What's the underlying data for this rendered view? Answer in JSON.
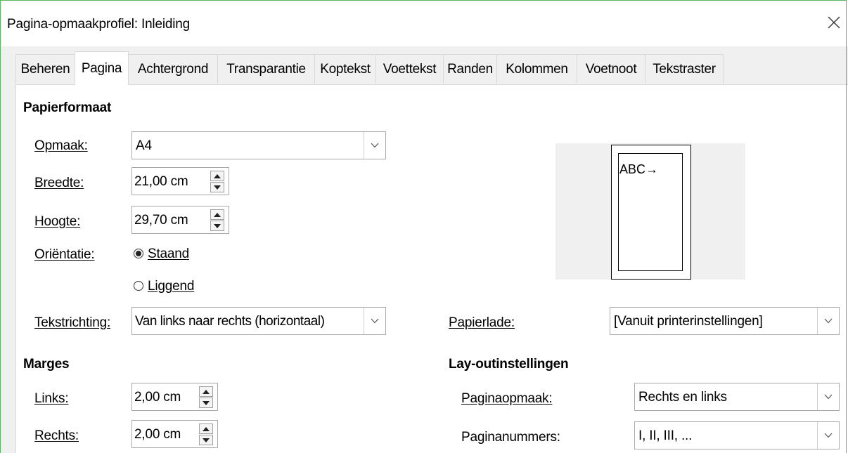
{
  "window": {
    "title": "Pagina-opmaakprofiel: Inleiding",
    "close_icon": "close-icon"
  },
  "tabs": [
    "Beheren",
    "Pagina",
    "Achtergrond",
    "Transparantie",
    "Koptekst",
    "Voettekst",
    "Randen",
    "Kolommen",
    "Voetnoot",
    "Tekstraster"
  ],
  "active_tab": "Pagina",
  "paper_format": {
    "heading": "Papierformaat",
    "format_label": "Opmaak:",
    "format_value": "A4",
    "width_label": "Breedte:",
    "width_value": "21,00 cm",
    "height_label": "Hoogte:",
    "height_value": "29,70 cm",
    "orientation_label": "Oriëntatie:",
    "portrait_label": "Staand",
    "landscape_label": "Liggend",
    "orientation_selected": "Staand",
    "text_direction_label": "Tekstrichting:",
    "text_direction_value": "Van links naar rechts (horizontaal)"
  },
  "preview": {
    "sample_text": "ABC→"
  },
  "paper_tray": {
    "label": "Papierlade:",
    "value": "[Vanuit printerinstellingen]"
  },
  "margins": {
    "heading": "Marges",
    "left_label": "Links:",
    "left_value": "2,00 cm",
    "right_label": "Rechts:",
    "right_value": "2,00 cm"
  },
  "layout": {
    "heading": "Lay-outinstellingen",
    "page_layout_label": "Paginaopmaak:",
    "page_layout_value": "Rechts en links",
    "page_numbers_label": "Paginanummers:",
    "page_numbers_value": "I, II, III, ..."
  },
  "colors": {
    "window_border": "#5bb35b",
    "dialog_bg": "#f0f0f0",
    "panel_bg": "#ffffff"
  }
}
